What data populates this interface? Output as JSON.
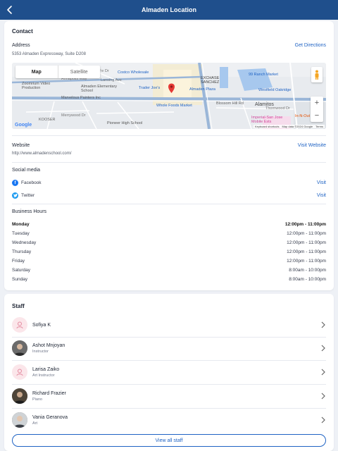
{
  "header": {
    "title": "Almaden Location"
  },
  "contact": {
    "heading": "Contact",
    "address_label": "Address",
    "address": "5353 Almaden Expressway, Suite D208",
    "directions_link": "Get Directions",
    "map": {
      "type_map": "Map",
      "type_satellite": "Satellite",
      "zoom_in": "+",
      "zoom_out": "−",
      "google": "Google",
      "attribution": [
        "Keyboard shortcuts",
        "Map data ©2024 Google",
        "Terms"
      ],
      "labels": [
        "Costco Wholesale",
        "Trader Joe's",
        "Almaden Plaza",
        "99 Ranch Market",
        "Westfield Oakridge",
        "Whole Foods Market",
        "Zoomrium Video Production",
        "Almaden Elementary School",
        "Marvelous Painters Inc",
        "Pioneer High School",
        "EXCHASE SANCHEZ",
        "Alamitos",
        "Blossom Hill Rd",
        "Imperial-San Jose Mobile Ests",
        "In-N-Out B",
        "KOOSER",
        "Thornwood Dr",
        "Annapolis Way",
        "Santa Fe Dr",
        "Lansing Ave",
        "Merrywood Dr"
      ]
    },
    "website_label": "Website",
    "website": "http://www.almadenschool.com/",
    "website_link": "Visit Website",
    "social_label": "Social media",
    "social": [
      {
        "name": "Facebook",
        "link": "Visit",
        "color": "#1877f2"
      },
      {
        "name": "Twitter",
        "link": "Visit",
        "color": "#1d9bf0"
      }
    ],
    "hours_label": "Business Hours",
    "hours": [
      {
        "day": "Monday",
        "time": "12:00pm - 11:00pm"
      },
      {
        "day": "Tuesday",
        "time": "12:00pm - 11:00pm"
      },
      {
        "day": "Wednesday",
        "time": "12:00pm - 11:00pm"
      },
      {
        "day": "Thursday",
        "time": "12:00pm - 11:00pm"
      },
      {
        "day": "Friday",
        "time": "12:00pm - 11:00pm"
      },
      {
        "day": "Saturday",
        "time": "8:00am - 10:00pm"
      },
      {
        "day": "Sunday",
        "time": "8:00am - 10:00pm"
      }
    ]
  },
  "staff": {
    "heading": "Staff",
    "members": [
      {
        "name": "Sofiya K",
        "role": "",
        "avatar": "placeholder"
      },
      {
        "name": "Ashot Mnjoyan",
        "role": "Instructor",
        "avatar": "photo"
      },
      {
        "name": "Larisa Zaiko",
        "role": "Art Instructor",
        "avatar": "placeholder"
      },
      {
        "name": "Richard Frazier",
        "role": "Piano",
        "avatar": "photo"
      },
      {
        "name": "Vania Geranova",
        "role": "Art",
        "avatar": "photo"
      }
    ],
    "view_all": "View all staff"
  },
  "colors": {
    "header": "#1f4f8c",
    "link": "#1f63c4",
    "background": "#eef1f6"
  }
}
